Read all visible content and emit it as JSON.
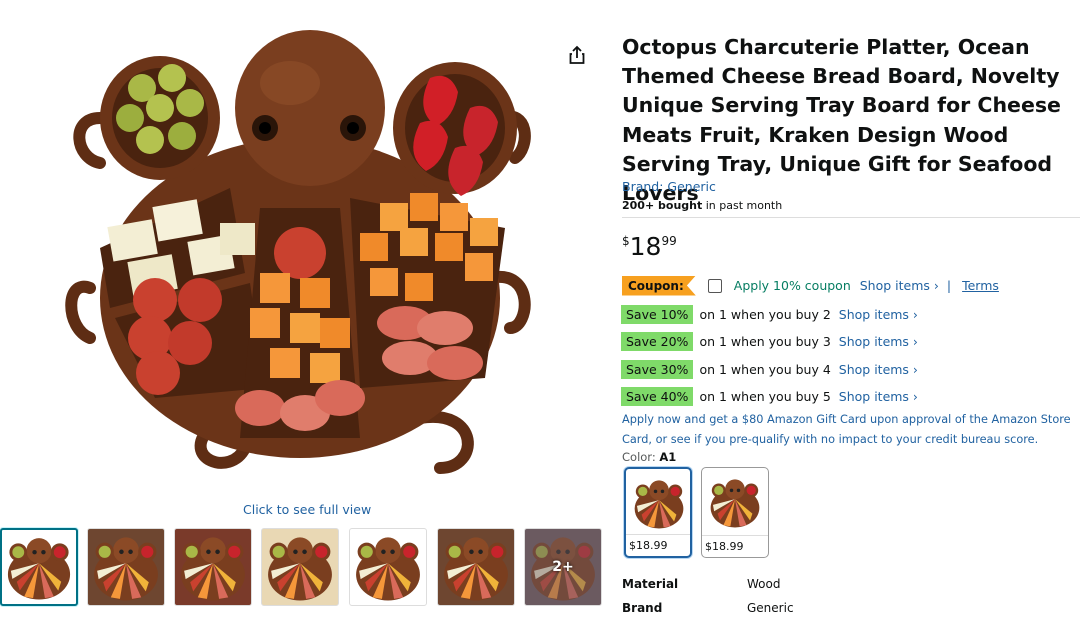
{
  "product": {
    "title": "Octopus Charcuterie Platter, Ocean Themed Cheese Bread Board, Novelty Unique Serving Tray Board for Cheese Meats Fruit, Kraken Design Wood Serving Tray, Unique Gift for Seafood Lovers",
    "brand_link": "Brand: Generic",
    "bought_bold": "200+ bought",
    "bought_rest": " in past month"
  },
  "price": {
    "symbol": "$",
    "whole": "18",
    "fraction": "99"
  },
  "coupon": {
    "tag": "Coupon:",
    "apply": "Apply 10% coupon",
    "shop": "Shop items ›",
    "separator": "|",
    "terms": "Terms"
  },
  "savings": [
    {
      "badge": "Save 10%",
      "text": "on 1 when you buy 2",
      "shop": "Shop items ›"
    },
    {
      "badge": "Save 20%",
      "text": "on 1 when you buy 3",
      "shop": "Shop items ›"
    },
    {
      "badge": "Save 30%",
      "text": "on 1 when you buy 4",
      "shop": "Shop items ›"
    },
    {
      "badge": "Save 40%",
      "text": "on 1 when you buy 5",
      "shop": "Shop items ›"
    }
  ],
  "card_offer": "Apply now and get a $80 Amazon Gift Card upon approval of the Amazon Store Card, or see if you pre-qualify with no impact to your credit bureau score.",
  "color": {
    "label": "Color:",
    "value": "A1"
  },
  "swatches": [
    {
      "price": "$18.99",
      "selected": true
    },
    {
      "price": "$18.99",
      "selected": false
    }
  ],
  "gallery": {
    "full_view": "Click to see full view",
    "more_count": "2+"
  },
  "attributes": [
    {
      "key": "Material",
      "value": "Wood"
    },
    {
      "key": "Brand",
      "value": "Generic"
    }
  ],
  "icons": {
    "share": "share-icon"
  }
}
